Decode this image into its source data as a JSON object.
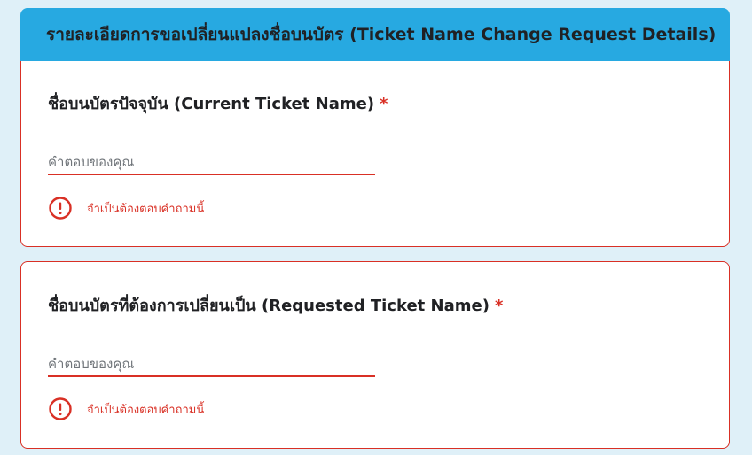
{
  "section": {
    "title": "รายละเอียดการขอเปลี่ยนแปลงชื่อบนบัตร (Ticket Name Change Request Details)",
    "header_color": "#27a9e1"
  },
  "questions": [
    {
      "label": "ชื่อบนบัตรปัจจุบัน (Current Ticket Name)",
      "required_mark": "*",
      "placeholder": "คำตอบของคุณ",
      "value": "",
      "error": "จำเป็นต้องตอบคำถามนี้",
      "error_icon": "error-circle-icon"
    },
    {
      "label": "ชื่อบนบัตรที่ต้องการเปลี่ยนเป็น (Requested Ticket Name)",
      "required_mark": "*",
      "placeholder": "คำตอบของคุณ",
      "value": "",
      "error": "จำเป็นต้องตอบคำถามนี้",
      "error_icon": "error-circle-icon"
    }
  ],
  "colors": {
    "error": "#d93025",
    "background": "#dff0f8"
  }
}
